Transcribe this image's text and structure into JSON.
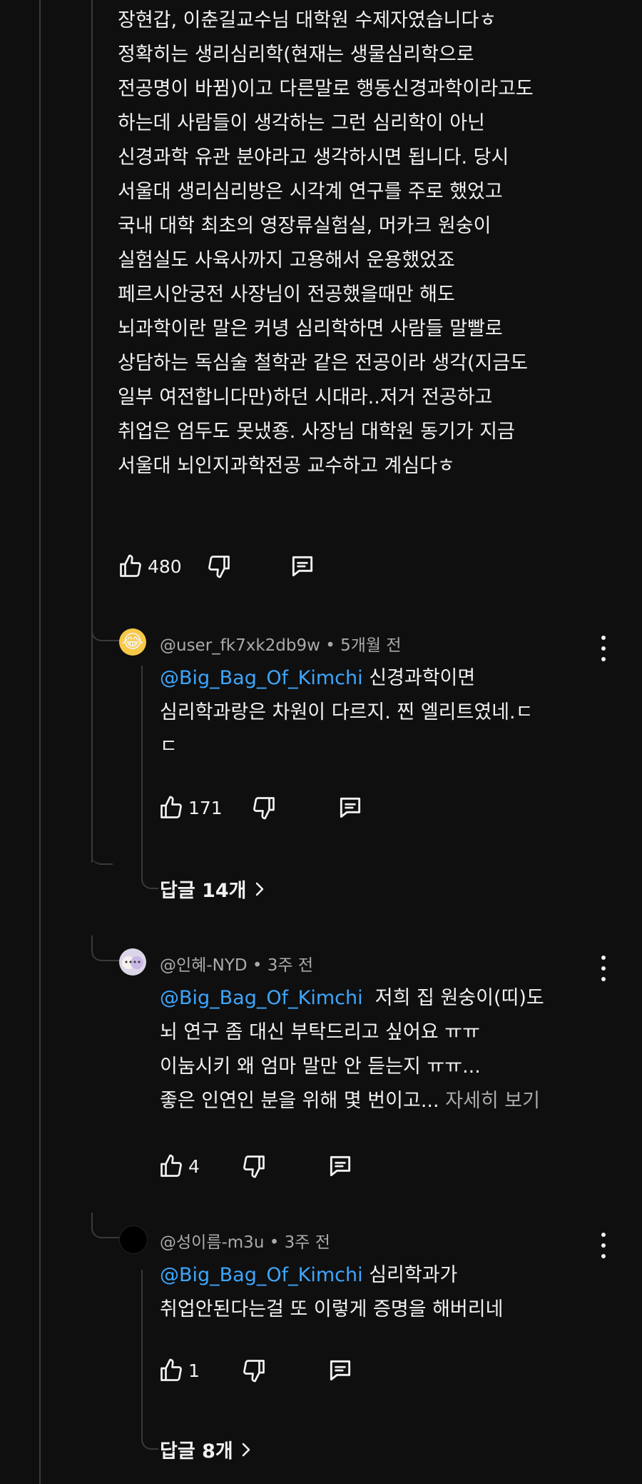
{
  "top_comment": {
    "lines": [
      "장현갑, 이춘길교수님 대학원 수제자였습니다ㅎ",
      "정확히는 생리심리학(현재는 생물심리학으로",
      "전공명이 바뀜)이고 다른말로 행동신경과학이라고도",
      "하는데 사람들이 생각하는 그런 심리학이 아닌",
      "신경과학 유관 분야라고 생각하시면 됩니다. 당시",
      "서울대 생리심리방은 시각계 연구를 주로 했었고",
      "국내 대학 최초의 영장류실험실, 머카크 원숭이",
      "실험실도 사육사까지 고용해서 운용했었죠",
      "페르시안궁전 사장님이 전공했을때만 해도",
      "뇌과학이란 말은 커녕 심리학하면 사람들 말빨로",
      "상담하는 독심술 철학관 같은 전공이라 생각(지금도",
      "일부 여전합니다만)하던 시대라..저거 전공하고",
      "취업은 엄두도 못냈죵. 사장님 대학원 동기가 지금",
      "서울대 뇌인지과학전공 교수하고 계심다ㅎ"
    ],
    "like_count": "480"
  },
  "replies": [
    {
      "author": "@user_fk7xk2db9w",
      "time": "5개월 전",
      "avatar_emoji": "😂",
      "mention": "@Big_Bag_Of_Kimchi",
      "first_line_rest": " 신경과학이면",
      "lines": [
        "심리학과랑은 차원이 다르지. 찐 엘리트였네.ㄷ",
        "ㄷ"
      ],
      "more": "",
      "like_count": "171",
      "replies_label": "답글 14개"
    },
    {
      "author": "@인혜-NYD",
      "time": "3주 전",
      "avatar_emoji": "",
      "mention": "@Big_Bag_Of_Kimchi",
      "first_line_rest": "  저희 집 원숭이(띠)도",
      "lines": [
        "뇌 연구 좀 대신 부탁드리고 싶어요 ㅠㅠ",
        "이눔시키 왜 엄마 말만 안 듣는지 ㅠㅠ..."
      ],
      "last_line": "좋은 인연인 분을 위해 몇 번이고...",
      "more": "자세히 보기",
      "like_count": "4",
      "replies_label": ""
    },
    {
      "author": "@성이름-m3u",
      "time": "3주 전",
      "avatar_emoji": "",
      "mention": "@Big_Bag_Of_Kimchi",
      "first_line_rest": " 심리학과가",
      "lines": [
        "취업안된다는걸 또 이렇게 증명을 해버리네"
      ],
      "more": "",
      "like_count": "1",
      "replies_label": "답글 8개"
    }
  ],
  "separator": " • ",
  "icons": {
    "like": "thumbs-up-icon",
    "dislike": "thumbs-down-icon",
    "reply": "comment-icon",
    "more": "more-vert-icon",
    "chevron": "chevron-right-icon"
  },
  "colors": {
    "background": "#0f0f0f",
    "text": "#f1f1f1",
    "muted": "#aaaaaa",
    "mention": "#3ea6ff",
    "thread_line": "#3a3a3a"
  }
}
